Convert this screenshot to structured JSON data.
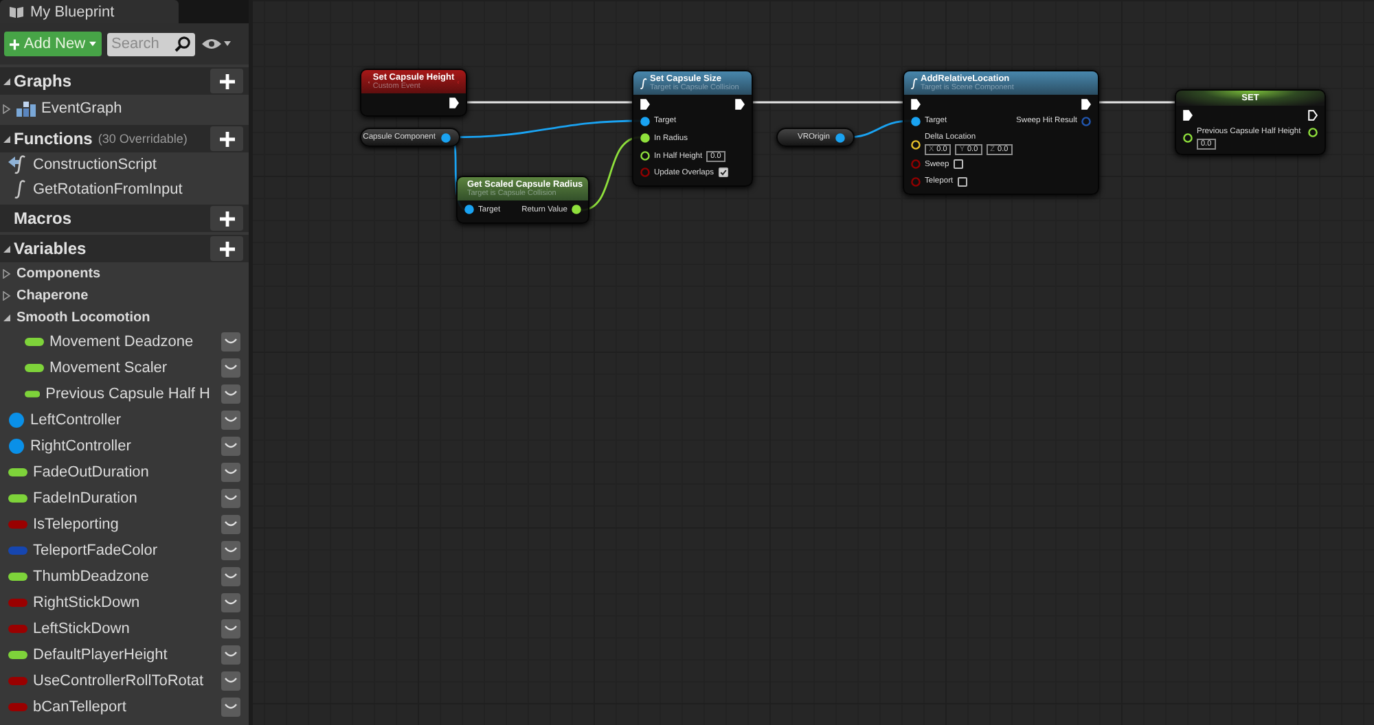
{
  "panel": {
    "tab": "My Blueprint",
    "add_button": "Add New",
    "search": {
      "placeholder": "Search"
    }
  },
  "sections": [
    {
      "title": "Graphs",
      "expanded": true,
      "items": [
        {
          "kind": "graph",
          "label": "EventGraph",
          "expanded": false
        }
      ]
    },
    {
      "title": "Functions",
      "note": "(30 Overridable)",
      "expanded": true,
      "items": [
        {
          "kind": "construction",
          "label": "ConstructionScript"
        },
        {
          "kind": "function",
          "label": "GetRotationFromInput"
        }
      ]
    },
    {
      "title": "Macros",
      "expanded": false
    },
    {
      "title": "Variables",
      "expanded": true,
      "items": [
        {
          "kind": "category",
          "label": "Components",
          "expanded": false
        },
        {
          "kind": "category",
          "label": "Chaperone",
          "expanded": false
        },
        {
          "kind": "category",
          "label": "Smooth Locomotion",
          "expanded": true,
          "children": [
            {
              "kind": "variable",
              "label": "Movement Deadzone",
              "color": "#7ed33a"
            },
            {
              "kind": "variable",
              "label": "Movement Scaler",
              "color": "#7ed33a"
            },
            {
              "kind": "variable",
              "label": "Previous Capsule Half H",
              "color": "#7ed33a"
            }
          ]
        },
        {
          "kind": "reference",
          "label": "LeftController",
          "color": "#0a90e8"
        },
        {
          "kind": "reference",
          "label": "RightController",
          "color": "#0a90e8"
        },
        {
          "kind": "variable",
          "label": "FadeOutDuration",
          "color": "#7ed33a"
        },
        {
          "kind": "variable",
          "label": "FadeInDuration",
          "color": "#7ed33a"
        },
        {
          "kind": "variable",
          "label": "IsTeleporting",
          "color": "#9a0000"
        },
        {
          "kind": "variable",
          "label": "TeleportFadeColor",
          "color": "#1646b0"
        },
        {
          "kind": "variable",
          "label": "ThumbDeadzone",
          "color": "#7ed33a"
        },
        {
          "kind": "variable",
          "label": "RightStickDown",
          "color": "#9a0000"
        },
        {
          "kind": "variable",
          "label": "LeftStickDown",
          "color": "#9a0000"
        },
        {
          "kind": "variable",
          "label": "DefaultPlayerHeight",
          "color": "#7ed33a"
        },
        {
          "kind": "variable",
          "label": "UseControllerRollToRotat",
          "color": "#9a0000"
        },
        {
          "kind": "variable",
          "label": "bCanTelleport",
          "color": "#9a0000"
        }
      ]
    }
  ],
  "nodes": [
    {
      "kind": "event",
      "title": "Set Capsule Height",
      "subtitle": "Custom Event",
      "rows": [
        {
          "out": {
            "kind": "exec",
            "connected": true
          }
        }
      ]
    },
    {
      "kind": "getter",
      "title": "Capsule Component",
      "rows": [
        {
          "out": {
            "kind": "object",
            "connected": true
          }
        }
      ]
    },
    {
      "kind": "pure",
      "title": "Get Scaled Capsule Radius",
      "subtitle": "Target is Capsule Collision",
      "rows": [
        {
          "in": {
            "kind": "object",
            "label": "Target",
            "connected": true
          },
          "out": {
            "kind": "float",
            "label": "Return Value",
            "connected": true
          }
        }
      ]
    },
    {
      "kind": "function",
      "title": "Set Capsule Size",
      "subtitle": "Target is Capsule Collision",
      "rows": [
        {
          "in": {
            "kind": "exec",
            "connected": true
          },
          "out": {
            "kind": "exec",
            "connected": true
          }
        },
        {
          "in": {
            "kind": "object",
            "label": "Target",
            "connected": true
          }
        },
        {
          "in": {
            "kind": "float",
            "label": "In Radius",
            "connected": true
          }
        },
        {
          "in": {
            "kind": "float",
            "label": "In Half Height",
            "connected": false,
            "value": "0.0"
          }
        },
        {
          "in": {
            "kind": "bool",
            "label": "Update Overlaps",
            "connected": false,
            "checked": true
          }
        }
      ]
    },
    {
      "kind": "getter",
      "title": "VROrigin",
      "rows": [
        {
          "out": {
            "kind": "object",
            "connected": true
          }
        }
      ]
    },
    {
      "kind": "function",
      "title": "AddRelativeLocation",
      "subtitle": "Target is Scene Component",
      "rows": [
        {
          "in": {
            "kind": "exec",
            "connected": true
          },
          "out": {
            "kind": "exec",
            "connected": true
          }
        },
        {
          "in": {
            "kind": "object",
            "label": "Target",
            "connected": true
          },
          "out": {
            "kind": "struct",
            "label": "Sweep Hit Result",
            "connected": false
          }
        },
        {
          "in": {
            "kind": "vector",
            "label": "Delta Location",
            "connected": false,
            "fields": [
              {
                "axis": "X",
                "value": "0.0"
              },
              {
                "axis": "Y",
                "value": "0.0"
              },
              {
                "axis": "Z",
                "value": "0.0"
              }
            ]
          }
        },
        {
          "in": {
            "kind": "bool",
            "label": "Sweep",
            "connected": false,
            "checked": false
          }
        },
        {
          "in": {
            "kind": "bool",
            "label": "Teleport",
            "connected": false,
            "checked": false
          }
        }
      ]
    },
    {
      "kind": "set",
      "title": "SET",
      "rows": [
        {
          "in": {
            "kind": "exec",
            "connected": true
          },
          "out": {
            "kind": "exec",
            "connected": false
          }
        },
        {
          "in": {
            "kind": "float",
            "label": "Previous Capsule Half Height",
            "connected": false,
            "fields": [
              {
                "value": "0.0"
              }
            ]
          },
          "out": {
            "kind": "float",
            "connected": false
          }
        }
      ]
    }
  ]
}
